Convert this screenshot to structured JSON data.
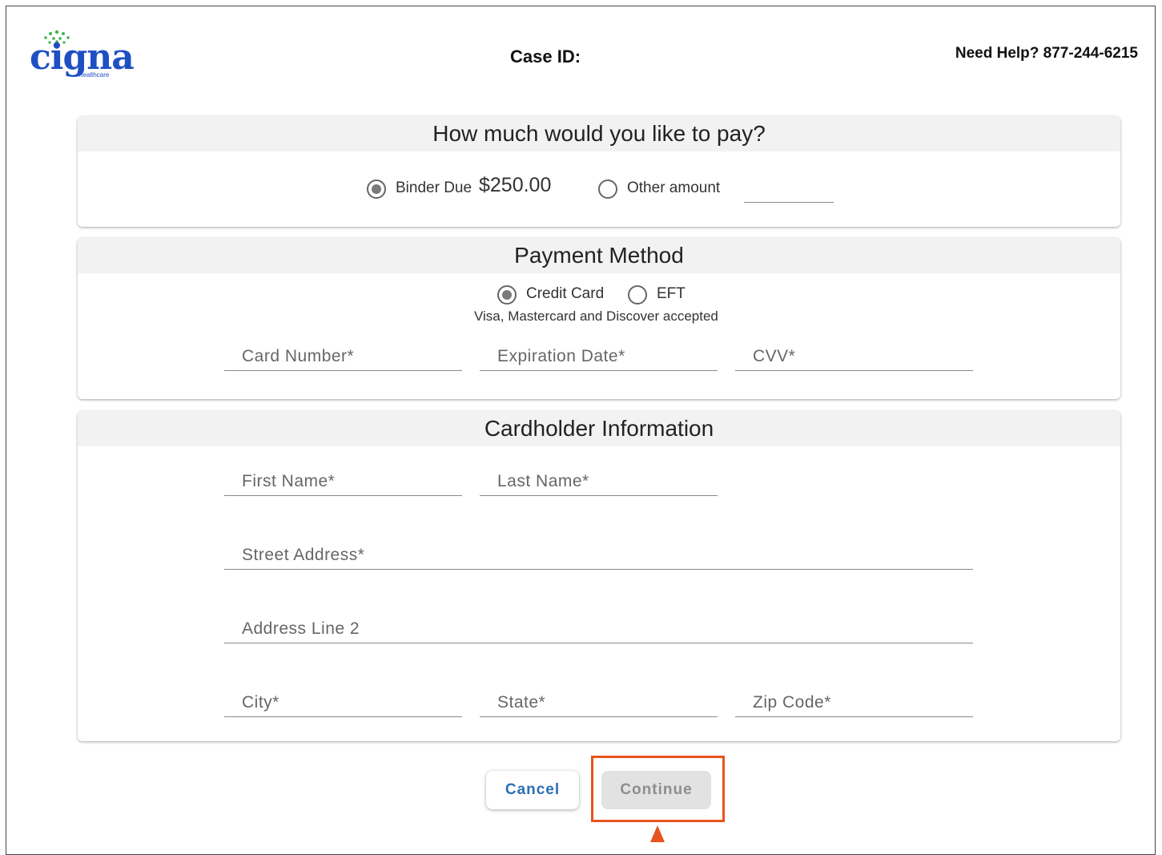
{
  "header": {
    "logo_text": "cigna",
    "logo_sub": "healthcare",
    "case_id_label": "Case ID:",
    "help_text": "Need Help? 877-244-6215"
  },
  "pay_section": {
    "title": "How much would you like to pay?",
    "binder_label": "Binder Due",
    "binder_amount": "$250.00",
    "other_label": "Other amount",
    "other_value": "",
    "selected": "binder"
  },
  "payment_method": {
    "title": "Payment Method",
    "credit_card_label": "Credit Card",
    "eft_label": "EFT",
    "accepted_note": "Visa, Mastercard and Discover accepted",
    "selected": "credit_card",
    "card_number_placeholder": "Card Number*",
    "expiration_placeholder": "Expiration Date*",
    "cvv_placeholder": "CVV*"
  },
  "cardholder": {
    "title": "Cardholder Information",
    "first_name_placeholder": "First Name*",
    "last_name_placeholder": "Last Name*",
    "street_placeholder": "Street Address*",
    "address2_placeholder": "Address Line 2",
    "city_placeholder": "City*",
    "state_placeholder": "State*",
    "zip_placeholder": "Zip Code*"
  },
  "actions": {
    "cancel_label": "Cancel",
    "continue_label": "Continue"
  },
  "colors": {
    "brand_blue": "#1f4fc4",
    "brand_green": "#3db54a",
    "highlight": "#e8541e",
    "link_blue": "#2d6fb4"
  }
}
